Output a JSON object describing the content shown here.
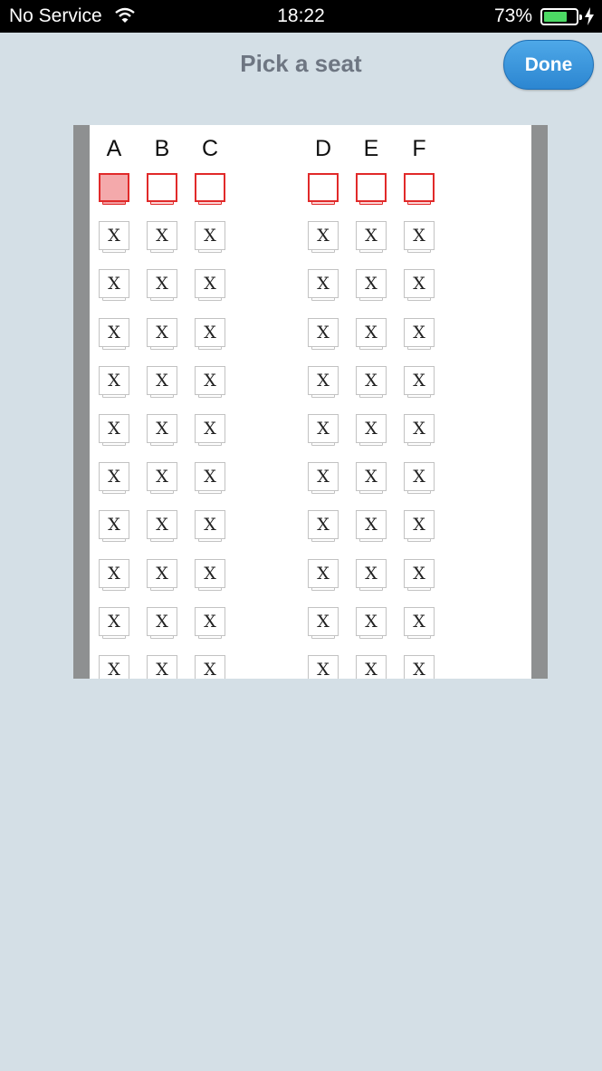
{
  "status_bar": {
    "carrier": "No Service",
    "time": "18:22",
    "battery_percent": "73%",
    "battery_level": 0.73,
    "icons": [
      "wifi-icon",
      "battery-icon",
      "charging-bolt-icon"
    ]
  },
  "nav": {
    "title": "Pick a seat",
    "done_label": "Done"
  },
  "seat_map": {
    "columns": [
      "A",
      "B",
      "C",
      "D",
      "E",
      "F"
    ],
    "unavailable_mark": "X",
    "rows": [
      [
        "selected",
        "available",
        "available",
        "available",
        "available",
        "available"
      ],
      [
        "taken",
        "taken",
        "taken",
        "taken",
        "taken",
        "taken"
      ],
      [
        "taken",
        "taken",
        "taken",
        "taken",
        "taken",
        "taken"
      ],
      [
        "taken",
        "taken",
        "taken",
        "taken",
        "taken",
        "taken"
      ],
      [
        "taken",
        "taken",
        "taken",
        "taken",
        "taken",
        "taken"
      ],
      [
        "taken",
        "taken",
        "taken",
        "taken",
        "taken",
        "taken"
      ],
      [
        "taken",
        "taken",
        "taken",
        "taken",
        "taken",
        "taken"
      ],
      [
        "taken",
        "taken",
        "taken",
        "taken",
        "taken",
        "taken"
      ],
      [
        "taken",
        "taken",
        "taken",
        "taken",
        "taken",
        "taken"
      ],
      [
        "taken",
        "taken",
        "taken",
        "taken",
        "taken",
        "taken"
      ],
      [
        "taken",
        "taken",
        "taken",
        "taken",
        "taken",
        "taken"
      ]
    ]
  },
  "colors": {
    "background": "#d4dfe6",
    "wall": "#8e9091",
    "seat_available": "#e12a2a",
    "seat_selected_fill": "#f4a9ab",
    "done_button": "#2c86d1"
  }
}
